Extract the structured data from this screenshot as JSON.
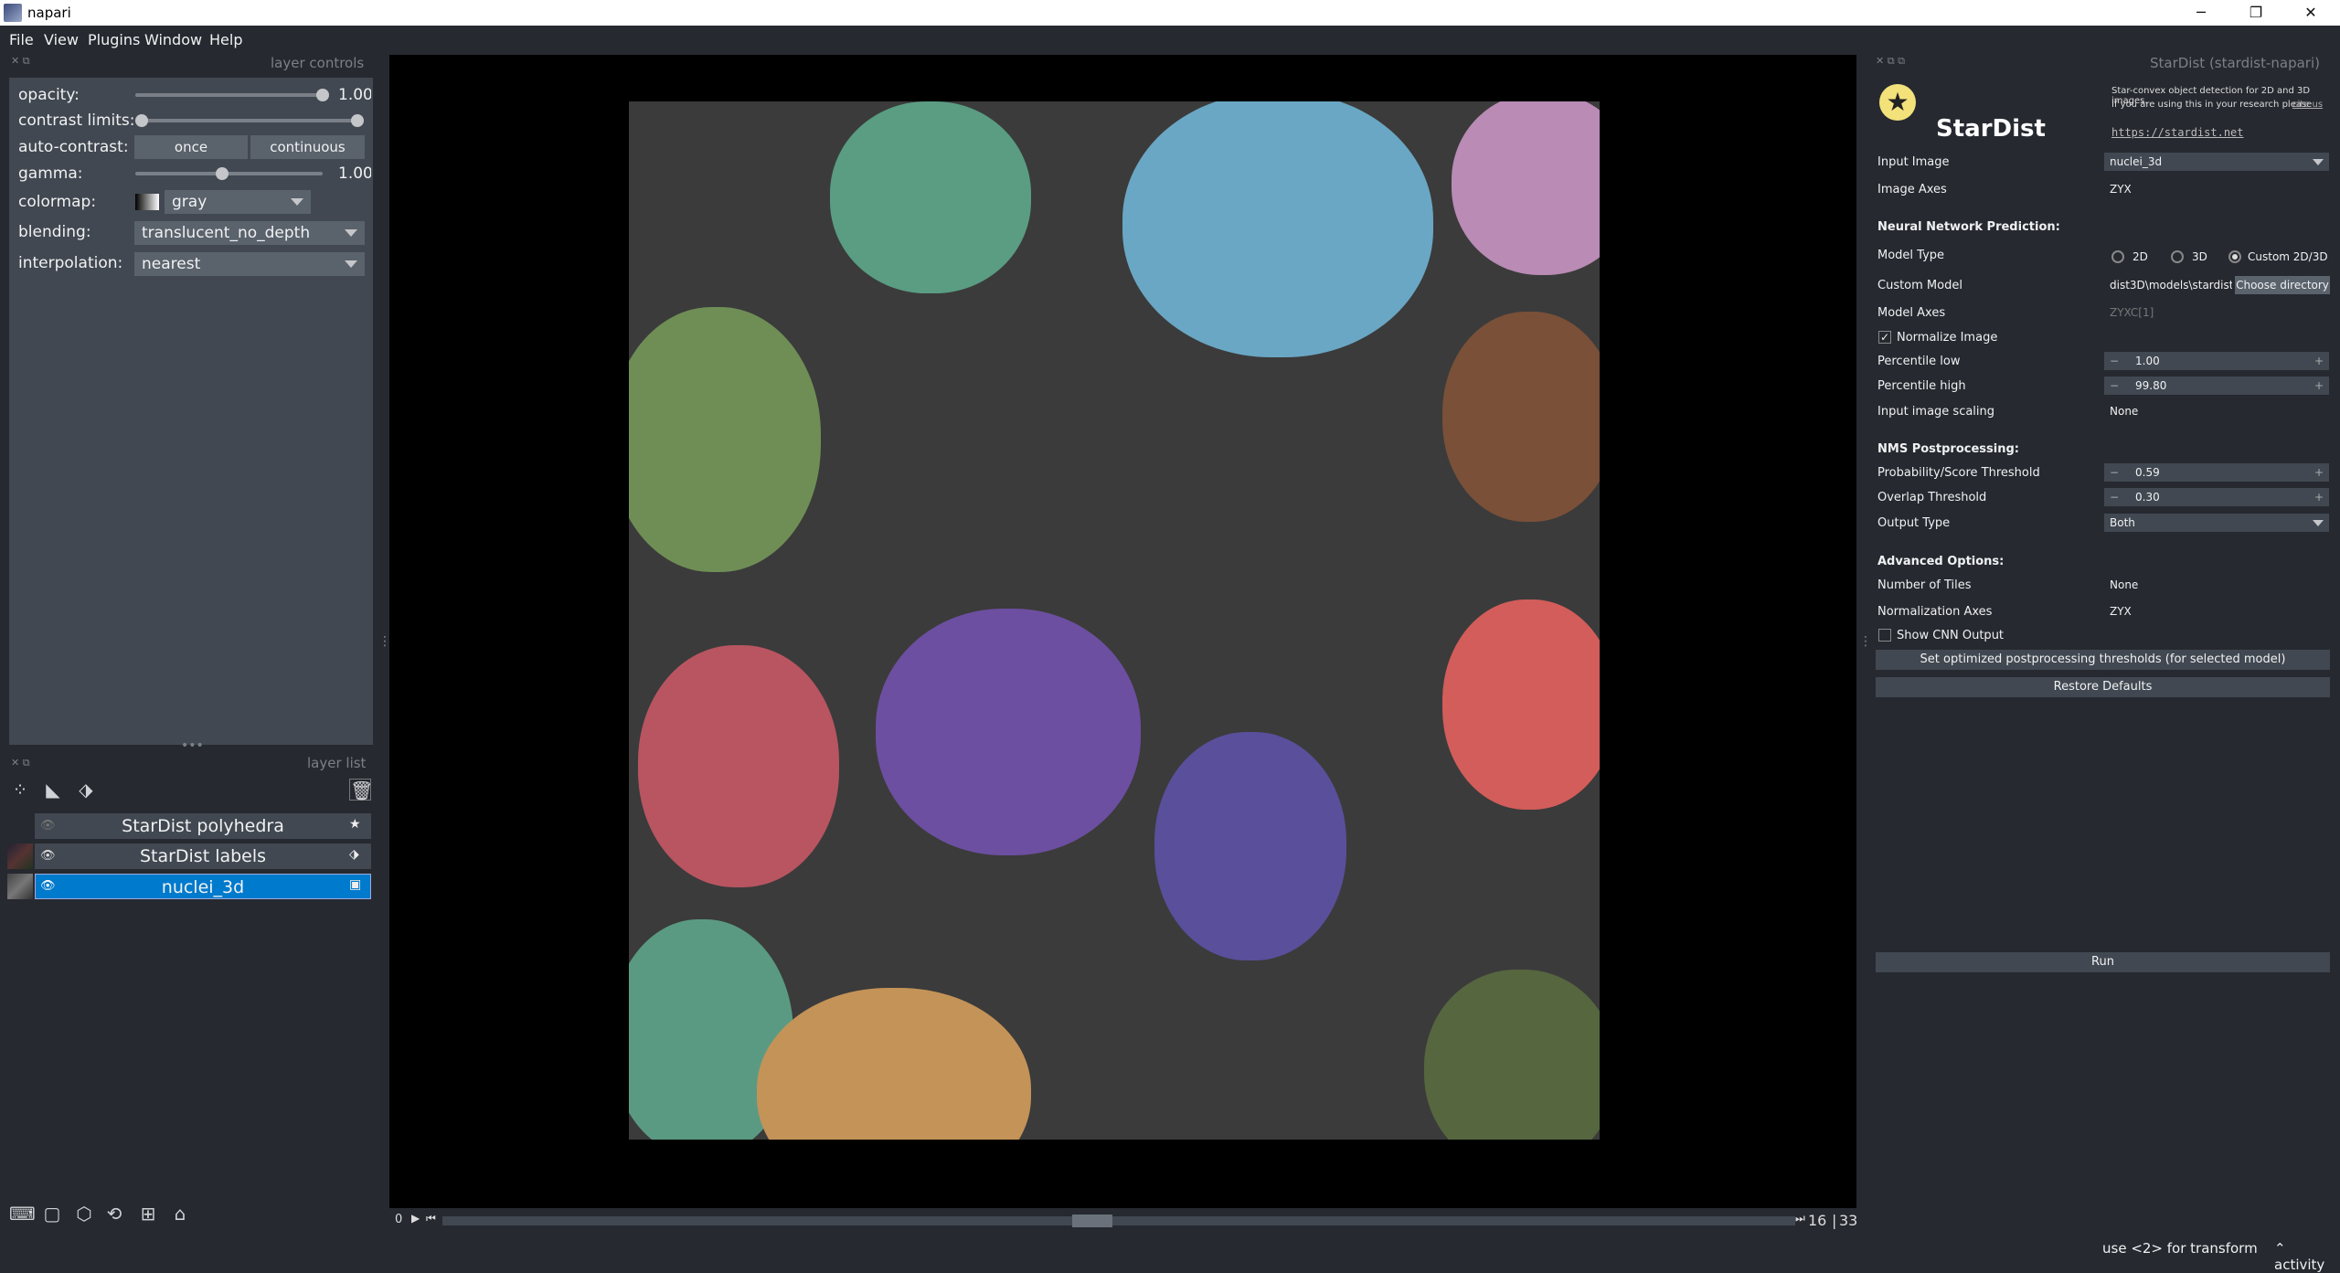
{
  "window": {
    "title": "napari",
    "minimize": "─",
    "restore": "❐",
    "close": "✕"
  },
  "menu": [
    "File",
    "View",
    "Plugins",
    "Window",
    "Help"
  ],
  "layer_controls": {
    "header": "layer controls",
    "opacity": {
      "label": "opacity:",
      "value": "1.00",
      "level": 1.0
    },
    "contrast_limits": {
      "label": "contrast limits:"
    },
    "auto_contrast": {
      "label": "auto-contrast:",
      "once": "once",
      "continuous": "continuous"
    },
    "gamma": {
      "label": "gamma:",
      "value": "1.00",
      "level": 0.5
    },
    "colormap": {
      "label": "colormap:",
      "value": "gray"
    },
    "blending": {
      "label": "blending:",
      "value": "translucent_no_depth"
    },
    "interpolation": {
      "label": "interpolation:",
      "value": "nearest"
    }
  },
  "layer_list": {
    "header": "layer list",
    "layers": [
      {
        "name": "StarDist polyhedra",
        "selected": false,
        "visible": false,
        "type_icon": "star-icon"
      },
      {
        "name": "StarDist labels",
        "selected": false,
        "visible": true,
        "type_icon": "tag-icon"
      },
      {
        "name": "nuclei_3d",
        "selected": true,
        "visible": true,
        "type_icon": "image-icon"
      }
    ]
  },
  "dims": {
    "start": "0",
    "current": "16",
    "total": "33",
    "slider_fraction": 0.48
  },
  "status": {
    "hint": "use <2> for transform",
    "activity": "activity"
  },
  "stardist": {
    "panel_title": "StarDist (stardist-napari)",
    "logo_text": "StarDist",
    "description_1": "Star-convex object detection for 2D and 3D images.",
    "description_2": "If you are using this in your research please",
    "cite_link": "cite us",
    "url": "https://stardist.net",
    "input_image_label": "Input Image",
    "input_image": "nuclei_3d",
    "image_axes_label": "Image Axes",
    "image_axes": "ZYX",
    "nn_header": "Neural Network Prediction:",
    "model_type_label": "Model Type",
    "model_2d": "2D",
    "model_3d": "3D",
    "model_custom": "Custom 2D/3D",
    "custom_model_label": "Custom Model",
    "custom_model": "dist3D\\models\\stardist",
    "choose_dir": "Choose directory",
    "model_axes_label": "Model Axes",
    "model_axes": "ZYXC[1]",
    "normalize_label": "Normalize Image",
    "perc_low_label": "Percentile low",
    "perc_low": "1.00",
    "perc_high_label": "Percentile high",
    "perc_high": "99.80",
    "scaling_label": "Input image scaling",
    "scaling": "None",
    "nms_header": "NMS Postprocessing:",
    "prob_label": "Probability/Score Threshold",
    "prob": "0.59",
    "overlap_label": "Overlap Threshold",
    "overlap": "0.30",
    "output_label": "Output Type",
    "output": "Both",
    "adv_header": "Advanced Options:",
    "tiles_label": "Number of Tiles",
    "tiles": "None",
    "norm_axes_label": "Normalization Axes",
    "norm_axes": "ZYX",
    "cnn_label": "Show CNN Output",
    "set_thresholds": "Set optimized postprocessing thresholds (for selected model)",
    "restore": "Restore Defaults",
    "run": "Run"
  },
  "colors": {
    "bg": "#262930",
    "panel": "#414851",
    "accent": "#007acc"
  }
}
